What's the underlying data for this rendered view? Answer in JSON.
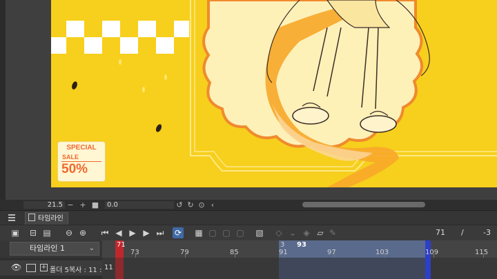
{
  "canvas": {
    "badge": {
      "title": "SPECIAL",
      "sale": "SALE",
      "percent": "50%"
    }
  },
  "status_bar": {
    "rotation": "21.5",
    "zoom_value": "0.0"
  },
  "panel": {
    "tab_label": "타임라인"
  },
  "toolbar": {
    "current_frame": "71",
    "separator": "/",
    "offset": "-3"
  },
  "timeline": {
    "selector_label": "타임라인 1",
    "playhead_label": "71",
    "range_start": "3",
    "range_end": "93",
    "ruler_labels": [
      "73",
      "79",
      "85",
      "91",
      "97",
      "103",
      "109",
      "115"
    ]
  },
  "track": {
    "name": "폴더 5복사 : 11 :",
    "frame_cell": "11"
  },
  "colors": {
    "artwork_bg": "#f7cf1d",
    "accent_orange": "#ef6a2f",
    "playhead": "#c0272d",
    "range_fill": "#5a6a8c",
    "range_end_marker": "#2e3fc7",
    "active_button": "#3f6aa6"
  }
}
